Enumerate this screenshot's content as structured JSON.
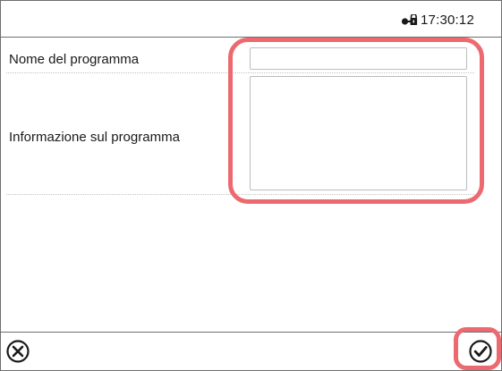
{
  "status_bar": {
    "time": "17:30:12",
    "lock_icon": "lock-icon"
  },
  "form": {
    "program_name": {
      "label": "Nome del programma",
      "value": ""
    },
    "program_info": {
      "label": "Informazione sul programma",
      "value": ""
    }
  },
  "toolbar": {
    "cancel_icon": "close-circle-icon",
    "confirm_icon": "check-circle-icon"
  },
  "colors": {
    "highlight": "#ec6a6f",
    "border": "#6e6e6e",
    "input_border": "#bdbdbd"
  }
}
